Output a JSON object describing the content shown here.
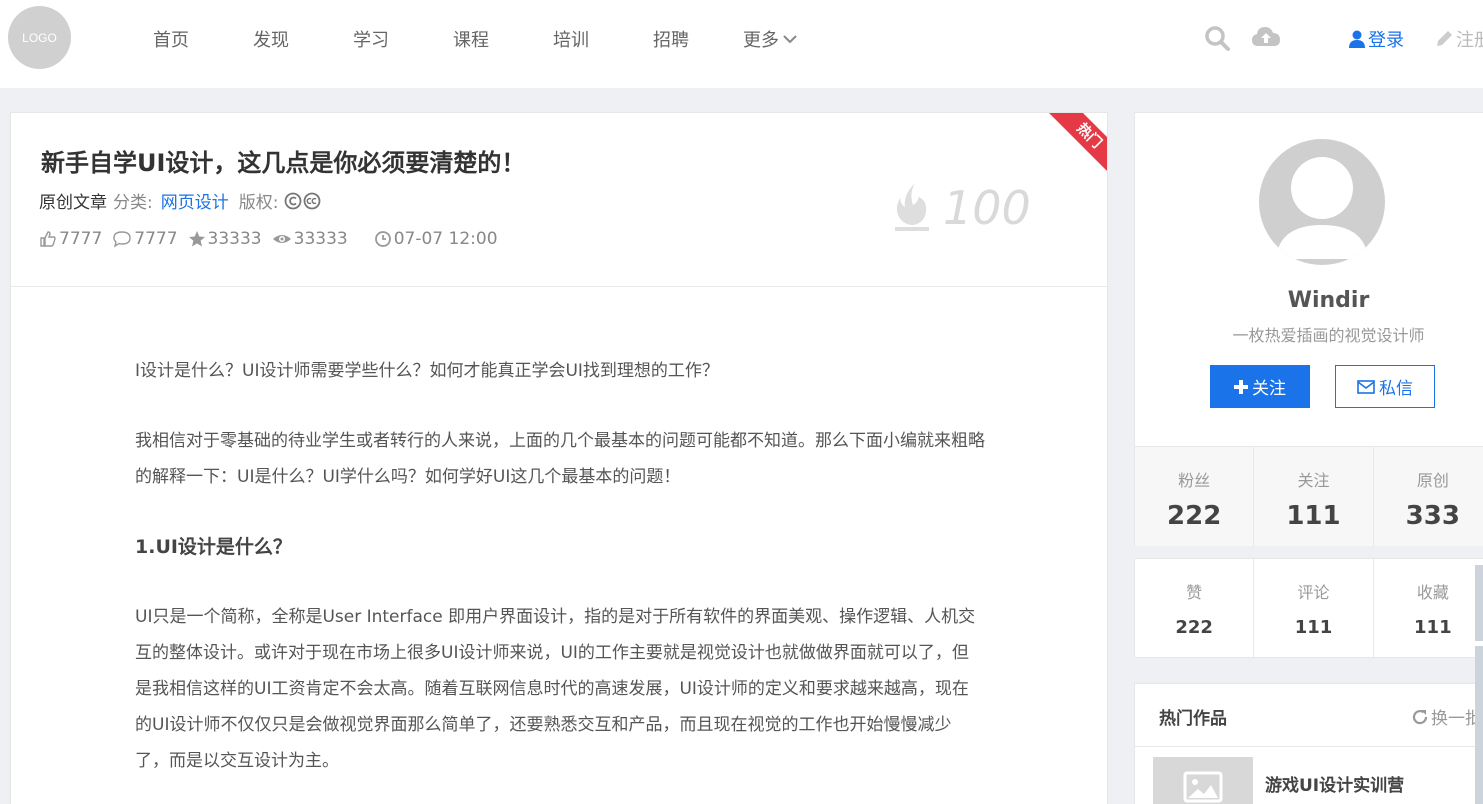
{
  "header": {
    "logo": "LOGO",
    "nav": [
      "首页",
      "发现",
      "学习",
      "课程",
      "培训",
      "招聘"
    ],
    "more": "更多",
    "login": "登录",
    "register": "注册",
    "icons": [
      "search-icon",
      "cloud-upload-icon",
      "user-icon",
      "pencil-icon",
      "chevron-down-icon"
    ]
  },
  "article": {
    "badge": "热门",
    "title": "新手自学UI设计，这几点是你必须要清楚的！",
    "original": "原创文章",
    "category_label": "分类:",
    "category": "网页设计",
    "copyright_label": "版权:",
    "likes": "7777",
    "comments": "7777",
    "stars": "33333",
    "views": "33333",
    "date": "07-07 12:00",
    "score": "100",
    "paragraphs": [
      "I设计是什么？UI设计师需要学些什么？如何才能真正学会UI找到理想的工作？",
      "我相信对于零基础的待业学生或者转行的人来说，上面的几个最基本的问题可能都不知道。那么下面小编就来粗略的解释一下：UI是什么？UI学什么吗？如何学好UI这几个最基本的问题！"
    ],
    "heading": "1.UI设计是什么？",
    "paragraph3": "UI只是一个简称，全称是User Interface 即用户界面设计，指的是对于所有软件的界面美观、操作逻辑、人机交互的整体设计。或许对于现在市场上很多UI设计师来说，UI的工作主要就是视觉设计也就做做界面就可以了，但是我相信这样的UI工资肯定不会太高。随着互联网信息时代的高速发展，UI设计师的定义和要求越来越高，现在的UI设计师不仅仅只是会做视觉界面那么简单了，还要熟悉交互和产品，而且现在视觉的工作也开始慢慢减少了，而是以交互设计为主。"
  },
  "profile": {
    "name": "Windir",
    "bio": "一枚热爱插画的视觉设计师",
    "follow": "关注",
    "message": "私信",
    "stats": [
      {
        "label": "粉丝",
        "value": "222"
      },
      {
        "label": "关注",
        "value": "111"
      },
      {
        "label": "原创",
        "value": "333"
      }
    ],
    "stats2": [
      {
        "label": "赞",
        "value": "222"
      },
      {
        "label": "评论",
        "value": "111"
      },
      {
        "label": "收藏",
        "value": "111"
      }
    ]
  },
  "hot": {
    "title": "热门作品",
    "swap": "换一批",
    "item_title": "游戏UI设计实训营"
  },
  "colors": {
    "accent": "#1a73e8",
    "badge": "#e63946"
  }
}
